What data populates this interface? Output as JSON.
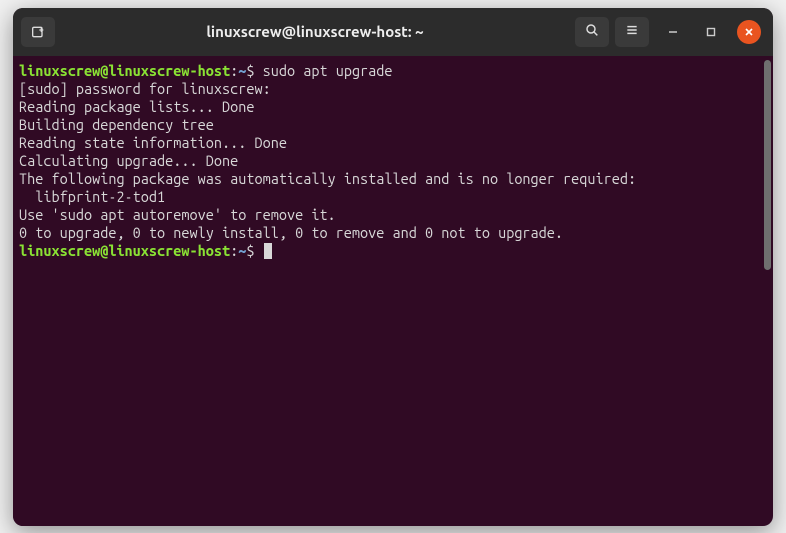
{
  "titlebar": {
    "title": "linuxscrew@linuxscrew-host: ~"
  },
  "prompt": {
    "user_host": "linuxscrew@linuxscrew-host",
    "path": "~",
    "symbol": "$"
  },
  "terminal": {
    "command1": "sudo apt upgrade",
    "lines": [
      "[sudo] password for linuxscrew:",
      "Reading package lists... Done",
      "Building dependency tree",
      "Reading state information... Done",
      "Calculating upgrade... Done",
      "The following package was automatically installed and is no longer required:",
      "  libfprint-2-tod1",
      "Use 'sudo apt autoremove' to remove it.",
      "0 to upgrade, 0 to newly install, 0 to remove and 0 not to upgrade."
    ]
  }
}
